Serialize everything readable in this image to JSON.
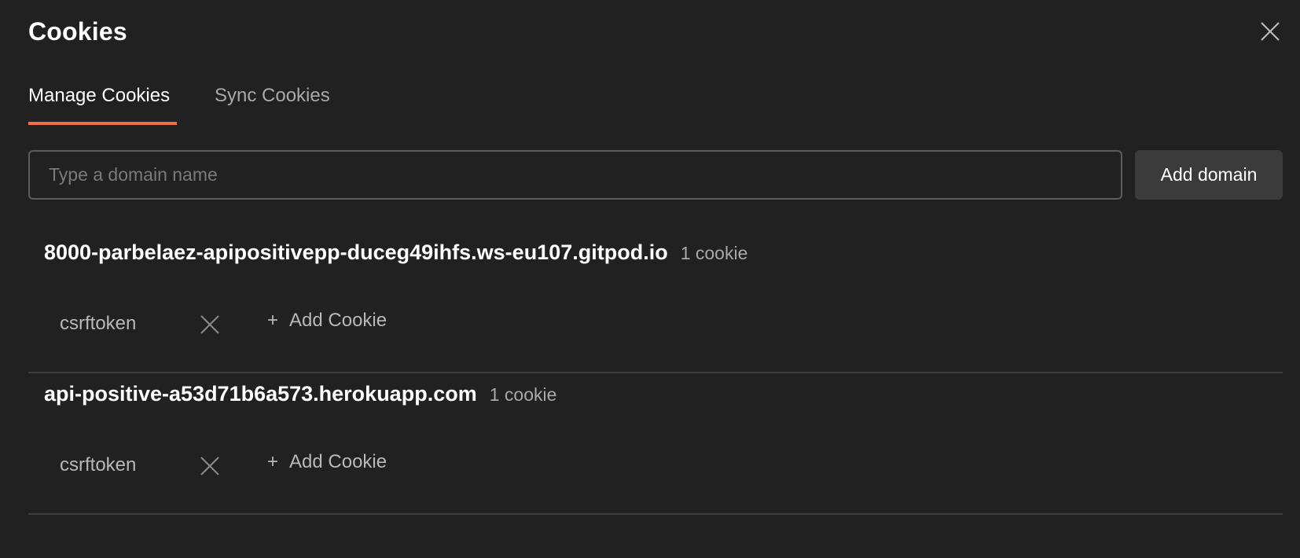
{
  "dialog": {
    "title": "Cookies",
    "close_icon": "close-icon"
  },
  "tabs": [
    {
      "label": "Manage Cookies",
      "active": true
    },
    {
      "label": "Sync Cookies",
      "active": false
    }
  ],
  "domain_input": {
    "placeholder": "Type a domain name",
    "value": ""
  },
  "add_domain_label": "Add domain",
  "domains": [
    {
      "name": "8000-parbelaez-apipositivepp-duceg49ihfs.ws-eu107.gitpod.io",
      "count": "1 cookie",
      "cookies": [
        {
          "name": "csrftoken"
        }
      ],
      "add_cookie_label": "Add Cookie"
    },
    {
      "name": "api-positive-a53d71b6a573.herokuapp.com",
      "count": "1 cookie",
      "cookies": [
        {
          "name": "csrftoken"
        }
      ],
      "add_cookie_label": "Add Cookie"
    }
  ],
  "colors": {
    "background": "#212121",
    "accent": "#ef7145",
    "button_bg": "#3b3b3b",
    "muted_text": "#a8a8a8"
  }
}
